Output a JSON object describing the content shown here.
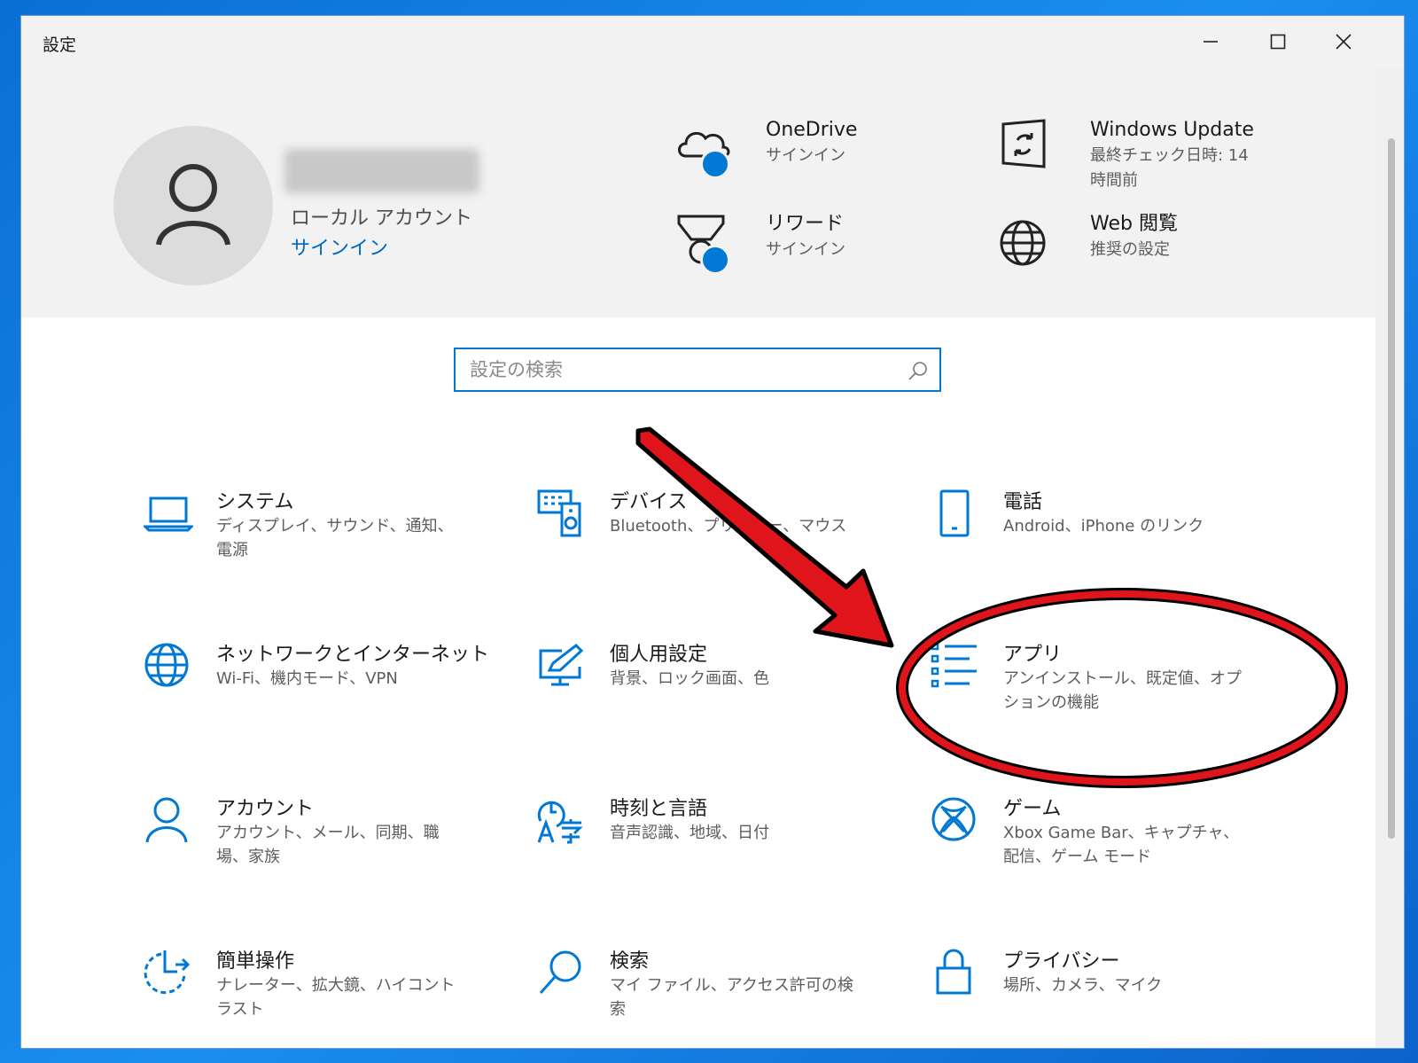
{
  "window": {
    "title": "設定"
  },
  "account": {
    "type": "ローカル アカウント",
    "signin": "サインイン"
  },
  "quick": [
    {
      "title": "OneDrive",
      "sub": "サインイン"
    },
    {
      "title": "Windows Update",
      "sub": "最終チェック日時: 14 時間前"
    },
    {
      "title": "リワード",
      "sub": "サインイン"
    },
    {
      "title": "Web 閲覧",
      "sub": "推奨の設定"
    }
  ],
  "search": {
    "placeholder": "設定の検索"
  },
  "tiles": [
    {
      "name": "システム",
      "desc": "ディスプレイ、サウンド、通知、電源",
      "icon": "laptop-icon"
    },
    {
      "name": "デバイス",
      "desc": "Bluetooth、プリンター、マウス",
      "icon": "devices-icon"
    },
    {
      "name": "電話",
      "desc": "Android、iPhone のリンク",
      "icon": "phone-icon"
    },
    {
      "name": "ネットワークとインターネット",
      "desc": "Wi-Fi、機内モード、VPN",
      "icon": "globe-icon"
    },
    {
      "name": "個人用設定",
      "desc": "背景、ロック画面、色",
      "icon": "personalize-icon"
    },
    {
      "name": "アプリ",
      "desc": "アンインストール、既定値、オプションの機能",
      "icon": "apps-list-icon"
    },
    {
      "name": "アカウント",
      "desc": "アカウント、メール、同期、職場、家族",
      "icon": "person-icon"
    },
    {
      "name": "時刻と言語",
      "desc": "音声認識、地域、日付",
      "icon": "time-language-icon"
    },
    {
      "name": "ゲーム",
      "desc": "Xbox Game Bar、キャプチャ、配信、ゲーム モード",
      "icon": "xbox-icon"
    },
    {
      "name": "簡単操作",
      "desc": "ナレーター、拡大鏡、ハイコントラスト",
      "icon": "ease-of-access-icon"
    },
    {
      "name": "検索",
      "desc": "マイ ファイル、アクセス許可の検索",
      "icon": "search-icon"
    },
    {
      "name": "プライバシー",
      "desc": "場所、カメラ、マイク",
      "icon": "lock-icon"
    }
  ],
  "colors": {
    "accent": "#0078d4",
    "annotation": "#e0141b",
    "header_bg": "#f2f2f2"
  }
}
